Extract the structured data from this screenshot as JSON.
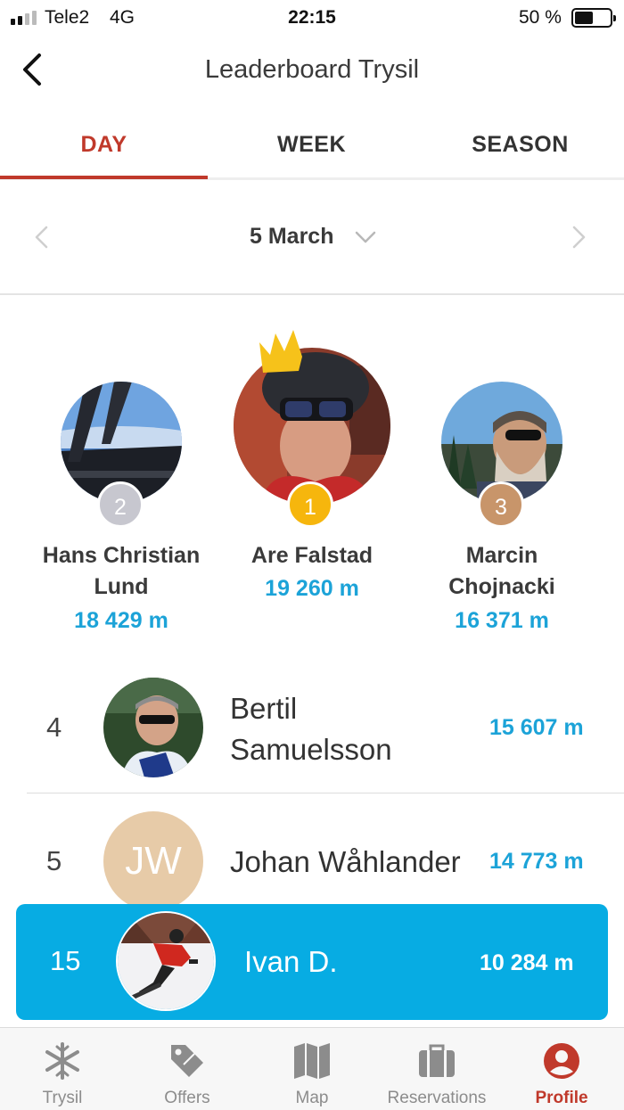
{
  "status_bar": {
    "carrier": "Tele2",
    "network": "4G",
    "time": "22:15",
    "battery": "50 %"
  },
  "header": {
    "title": "Leaderboard Trysil"
  },
  "tabs": [
    {
      "label": "DAY",
      "active": true
    },
    {
      "label": "WEEK",
      "active": false
    },
    {
      "label": "SEASON",
      "active": false
    }
  ],
  "date_nav": {
    "date": "5 March"
  },
  "podium": [
    {
      "rank": "2",
      "name_line1": "Hans Christian",
      "name_line2": "Lund",
      "distance": "18 429 m"
    },
    {
      "rank": "1",
      "name_line1": "Are Falstad",
      "name_line2": "",
      "distance": "19 260 m"
    },
    {
      "rank": "3",
      "name_line1": "Marcin",
      "name_line2": "Chojnacki",
      "distance": "16 371 m"
    }
  ],
  "list": [
    {
      "rank": "4",
      "name_line1": "Bertil",
      "name_line2": "Samuelsson",
      "distance": "15 607 m"
    },
    {
      "rank": "5",
      "name_line1": "Johan Wåhlander",
      "initials": "JW",
      "distance": "14 773 m"
    }
  ],
  "current_user": {
    "rank": "15",
    "name": "Ivan D.",
    "distance": "10 284 m"
  },
  "bottom_nav": [
    {
      "label": "Trysil",
      "icon": "snowflake-icon",
      "active": false
    },
    {
      "label": "Offers",
      "icon": "tag-icon",
      "active": false
    },
    {
      "label": "Map",
      "icon": "map-icon",
      "active": false
    },
    {
      "label": "Reservations",
      "icon": "suitcase-icon",
      "active": false
    },
    {
      "label": "Profile",
      "icon": "profile-icon",
      "active": true
    }
  ],
  "colors": {
    "accent_red": "#c0392b",
    "distance_blue": "#1ca3d8",
    "highlight_row": "#07ace3",
    "gold": "#f6b60d",
    "silver": "#c7c7cf",
    "bronze": "#c8956a"
  }
}
